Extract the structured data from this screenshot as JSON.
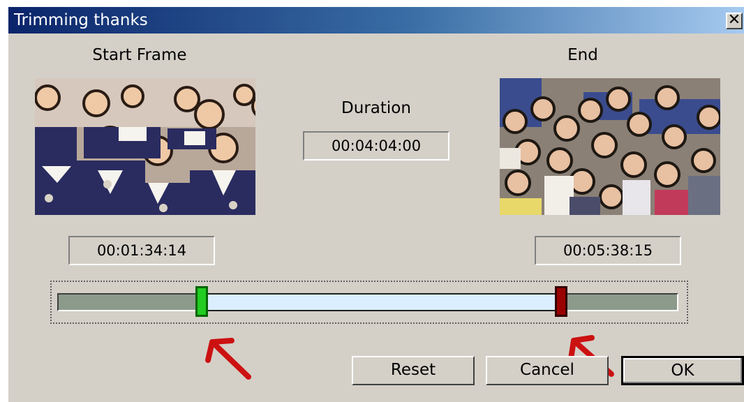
{
  "window": {
    "title": "Trimming thanks",
    "close_glyph": "✕"
  },
  "labels": {
    "start": "Start Frame",
    "end": "End",
    "duration": "Duration"
  },
  "timecodes": {
    "start": "00:01:34:14",
    "end": "00:05:38:15",
    "duration": "00:04:04:00"
  },
  "buttons": {
    "reset": "Reset",
    "cancel": "Cancel",
    "ok": "OK"
  },
  "trim": {
    "start_fraction": 0.233,
    "end_fraction": 0.811
  },
  "icons": [
    "close-icon",
    "red-arrow-annotation-icon"
  ],
  "colors": {
    "titlebar_start": "#0a246a",
    "titlebar_end": "#a6caf0",
    "dialog_bg": "#d4d0c8",
    "track": "#8c9a8c",
    "selection": "#dbeeff",
    "start_handle": "#22cc22",
    "end_handle": "#990000",
    "annotation": "#cc1111"
  }
}
